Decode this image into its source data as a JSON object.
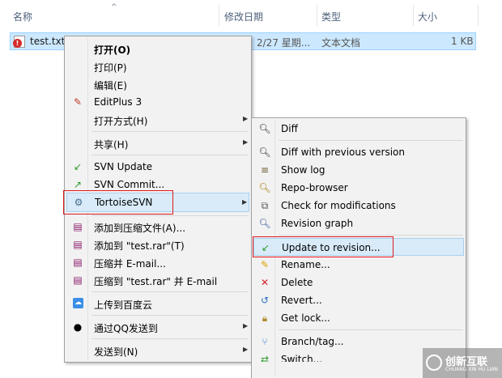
{
  "columns": {
    "name": "名称",
    "modified": "修改日期",
    "type": "类型",
    "size": "大小"
  },
  "file": {
    "name": "test.txt",
    "modified": "2/27 星期...",
    "type": "文本文档",
    "size": "1 KB"
  },
  "context_menu": [
    {
      "label": "打开(O)",
      "bold": true
    },
    {
      "label": "打印(P)"
    },
    {
      "label": "编辑(E)"
    },
    {
      "label": "EditPlus 3"
    },
    {
      "label": "打开方式(H)"
    },
    {
      "label": "共享(H)"
    },
    {
      "label": "SVN Update"
    },
    {
      "label": "SVN Commit..."
    },
    {
      "label": "TortoiseSVN"
    },
    {
      "label": "添加到压缩文件(A)..."
    },
    {
      "label": "添加到 \"test.rar\"(T)"
    },
    {
      "label": "压缩并 E-mail..."
    },
    {
      "label": "压缩到 \"test.rar\" 并 E-mail"
    },
    {
      "label": "上传到百度云"
    },
    {
      "label": "通过QQ发送到"
    },
    {
      "label": "发送到(N)"
    }
  ],
  "svn_menu": [
    {
      "label": "Diff"
    },
    {
      "label": "Diff with previous version"
    },
    {
      "label": "Show log"
    },
    {
      "label": "Repo-browser"
    },
    {
      "label": "Check for modifications"
    },
    {
      "label": "Revision graph"
    },
    {
      "label": "Update to revision..."
    },
    {
      "label": "Rename..."
    },
    {
      "label": "Delete"
    },
    {
      "label": "Revert..."
    },
    {
      "label": "Get lock..."
    },
    {
      "label": "Branch/tag..."
    },
    {
      "label": "Switch..."
    }
  ],
  "watermark": {
    "name": "创新互联",
    "sub": "CHUANG XIN HU LIAN"
  },
  "colors": {
    "selection": "#cce8ff",
    "highlight_box": "#e0191c",
    "menu_bg": "#f2f2f2"
  }
}
